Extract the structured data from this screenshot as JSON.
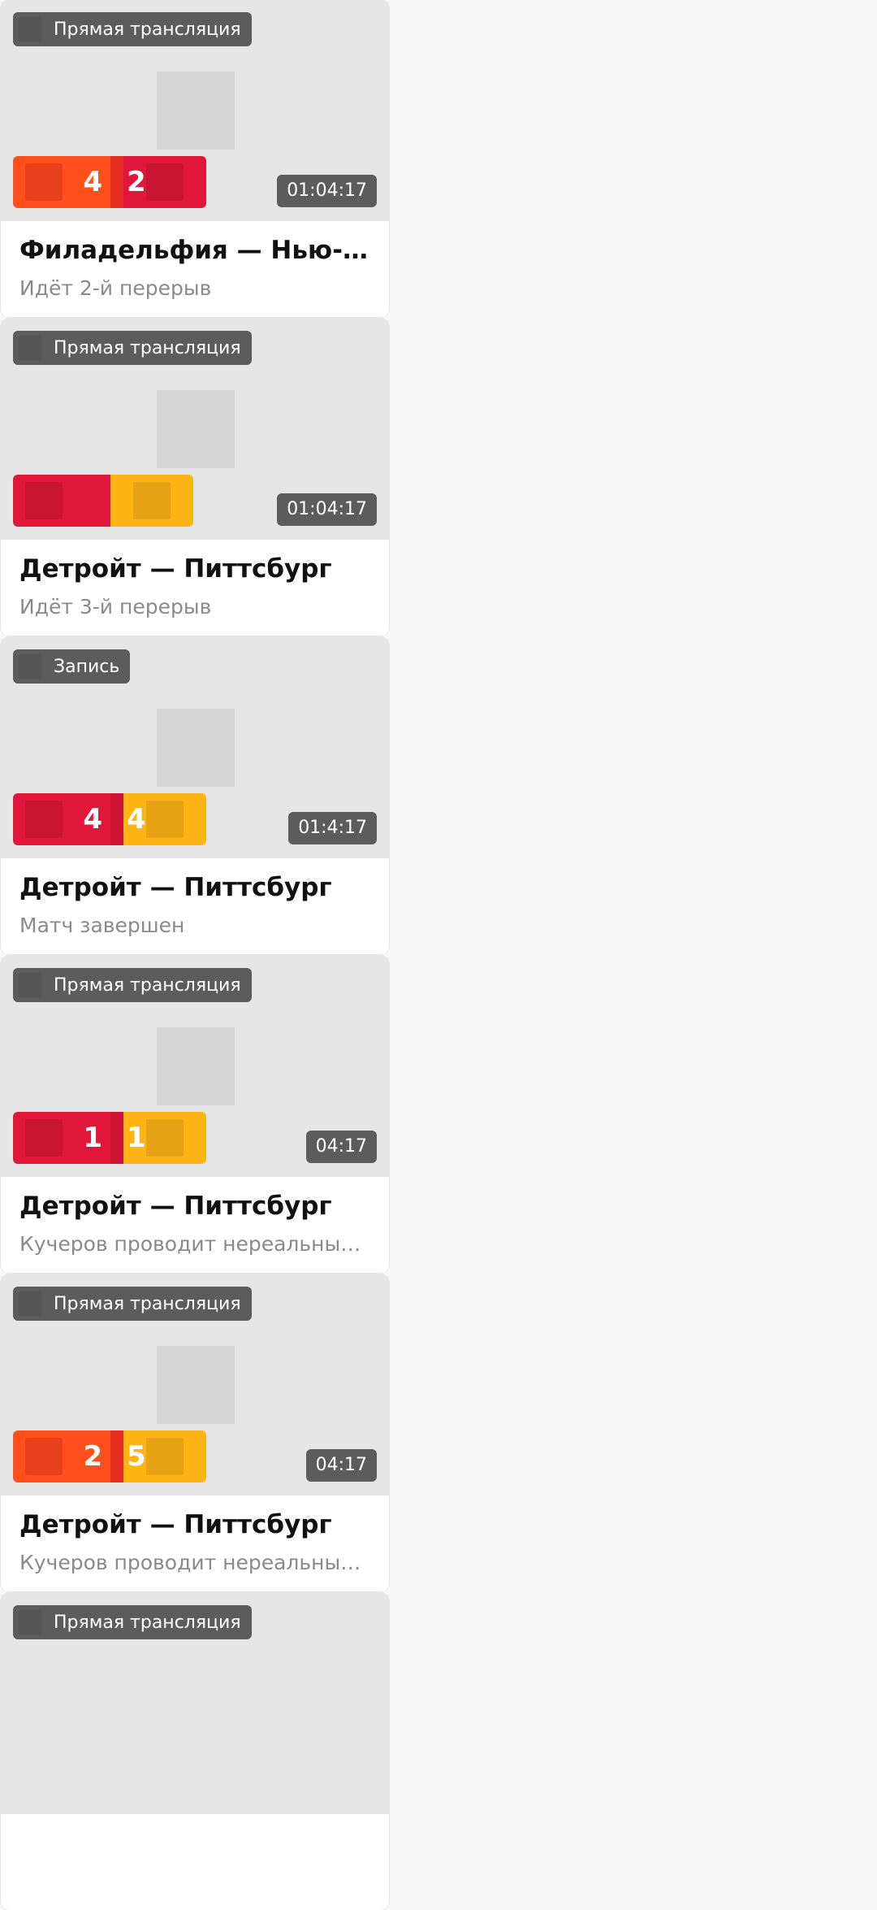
{
  "colors": {
    "badge_bg": "#5c5c5c",
    "thumb_bg": "#e6e6e6",
    "placeholder": "#d6d6d6",
    "team_orange": "#ff4f1c",
    "team_orange_logo": "#e8401c",
    "team_red": "#e0173a",
    "team_red_logo": "#c81534",
    "team_yellow": "#fdb515",
    "team_yellow_logo": "#e7a314",
    "divider_orange_red": "#e52d22",
    "divider_red": "#cc1232"
  },
  "cards": [
    {
      "badge": "Прямая трансляция",
      "badge_icon": "live-icon",
      "home_score": "4",
      "away_score": "2",
      "home_color": "team_orange",
      "away_color": "team_red",
      "duration": "01:04:17",
      "title": "Филадельфия — Нью-Джерси",
      "subtitle": "Идёт 2-й перерыв"
    },
    {
      "badge": "Прямая трансляция",
      "badge_icon": "live-icon",
      "home_score": "",
      "away_score": "",
      "home_color": "team_red",
      "away_color": "team_yellow",
      "duration": "01:04:17",
      "title": "Детройт — Питтсбург",
      "subtitle": "Идёт 3-й перерыв"
    },
    {
      "badge": "Запись",
      "badge_icon": "record-icon",
      "home_score": "4",
      "away_score": "4",
      "home_color": "team_red",
      "away_color": "team_yellow",
      "duration": "01:4:17",
      "title": "Детройт — Питтсбург",
      "subtitle": "Матч завершен"
    },
    {
      "badge": "Прямая трансляция",
      "badge_icon": "live-icon",
      "home_score": "1",
      "away_score": "1",
      "home_color": "team_red",
      "away_color": "team_yellow",
      "duration": "04:17",
      "title": "Детройт — Питтсбург",
      "subtitle": "Кучеров проводит нереальный сезон"
    },
    {
      "badge": "Прямая трансляция",
      "badge_icon": "live-icon",
      "home_score": "2",
      "away_score": "5",
      "home_color": "team_orange",
      "away_color": "team_yellow",
      "duration": "04:17",
      "title": "Детройт — Питтсбург",
      "subtitle": "Кучеров проводит нереальный сезон"
    },
    {
      "badge": "Прямая трансляция",
      "badge_icon": "live-icon"
    }
  ]
}
